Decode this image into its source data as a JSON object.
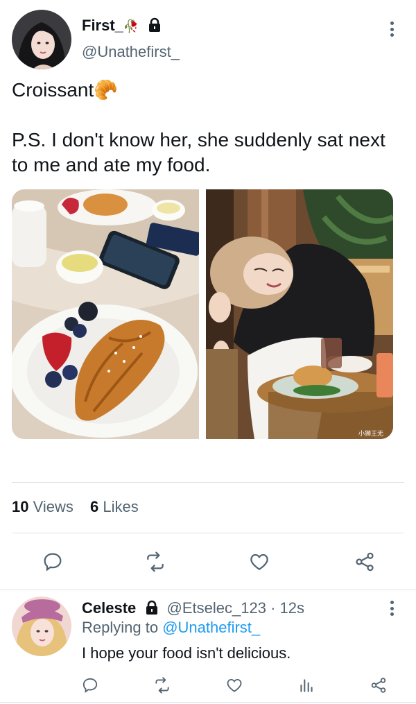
{
  "tweet": {
    "author_name": "First_",
    "author_name_emoji": "🥀",
    "handle": "@Unathefirst_",
    "text_line1": "Croissant",
    "text_emoji": "🥐",
    "text_body": "P.S. I don't know her, she suddenly sat next\nto me and ate my food.",
    "views_count": "10",
    "views_label": "Views",
    "likes_count": "6",
    "likes_label": "Likes"
  },
  "reply": {
    "author_name": "Celeste",
    "handle_time": "@Etselec_123 · 12s",
    "replying_prefix": "Replying to",
    "replying_to": "@Unathefirst_",
    "text": "I hope your food isn't delicious."
  },
  "photos": {
    "right_watermark": "小狮王无"
  },
  "icons": {
    "lock": "lock-icon",
    "more": "more-vertical-icon",
    "reply": "comment-icon",
    "retweet": "retweet-icon",
    "like": "heart-icon",
    "share": "share-icon",
    "analytics": "analytics-icon"
  },
  "colors": {
    "accent": "#1d9bf0",
    "secondary_text": "#536471",
    "primary_text": "#0f1419"
  }
}
